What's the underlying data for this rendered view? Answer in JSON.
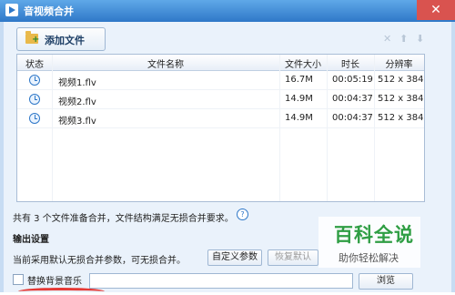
{
  "window": {
    "title": "音视频合并",
    "close_label": "✕"
  },
  "toolbar": {
    "add_file_label": "添加文件",
    "delete_icon": "✕",
    "up_icon": "⬆",
    "down_icon": "⬇"
  },
  "table": {
    "headers": [
      "状态",
      "文件名称",
      "文件大小",
      "时长",
      "分辨率"
    ],
    "rows": [
      {
        "status_icon": "clock-icon",
        "name": "视频1.flv",
        "size": "16.7M",
        "duration": "00:05:19",
        "resolution": "512 x 384"
      },
      {
        "status_icon": "clock-icon",
        "name": "视频2.flv",
        "size": "14.9M",
        "duration": "00:04:37",
        "resolution": "512 x 384"
      },
      {
        "status_icon": "clock-icon",
        "name": "视频3.flv",
        "size": "14.9M",
        "duration": "00:04:37",
        "resolution": "512 x 384"
      }
    ]
  },
  "summary": {
    "text": "共有 3 个文件准备合并，文件结构满足无损合并要求。",
    "help_icon": "?"
  },
  "output": {
    "title": "输出设置",
    "description": "当前采用默认无损合并参数，可无损合并。",
    "custom_button": "自定义参数",
    "restore_button": "恢复默认",
    "bgm_label": "替换背景音乐",
    "bgm_value": "",
    "browse_button": "浏览"
  },
  "watermark": {
    "big": "百科全说",
    "small": "助你轻松解决"
  }
}
